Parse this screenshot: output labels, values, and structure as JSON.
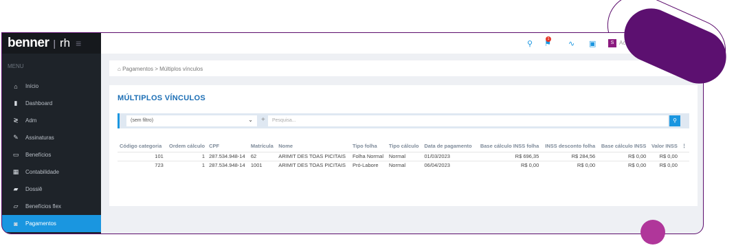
{
  "logo": {
    "brand": "benner",
    "module": "rh"
  },
  "sidebar": {
    "menu_heading": "MENU",
    "items": [
      {
        "label": "Início",
        "icon": "home-icon"
      },
      {
        "label": "Dashboard",
        "icon": "bar-chart-icon"
      },
      {
        "label": "Adm",
        "icon": "sliders-icon"
      },
      {
        "label": "Assinaturas",
        "icon": "signature-icon"
      },
      {
        "label": "Benefícios",
        "icon": "card-icon"
      },
      {
        "label": "Contabilidade",
        "icon": "calculator-icon"
      },
      {
        "label": "Dossiê",
        "icon": "folder-icon"
      },
      {
        "label": "Benefícios flex",
        "icon": "flex-card-icon"
      },
      {
        "label": "Pagamentos",
        "icon": "payment-icon",
        "active": true
      }
    ]
  },
  "topbar": {
    "notification_count": "1",
    "avatar_letter": "S",
    "user_label": "Ac"
  },
  "breadcrumb": {
    "text": "Pagamentos > Múltiplos vínculos"
  },
  "page": {
    "title": "MÚLTIPLOS VÍNCULOS"
  },
  "filter": {
    "selected": "(sem filtro)",
    "search_placeholder": "Pesquisa..."
  },
  "table": {
    "headers": [
      "Código categoria",
      "Ordem cálculo",
      "CPF",
      "Matrícula",
      "Nome",
      "Tipo folha",
      "Tipo cálculo",
      "Data de pagamento",
      "Base cálculo INSS folha",
      "INSS desconto folha",
      "Base cálculo INSS",
      "Valor INSS"
    ],
    "rows": [
      [
        "101",
        "1",
        "287.534.948-14",
        "62",
        "ARIMIT DES TOAS PICITAIS",
        "Folha Normal",
        "Normal",
        "01/03/2023",
        "R$ 696,35",
        "R$ 284,56",
        "R$ 0,00",
        "R$ 0,00"
      ],
      [
        "723",
        "1",
        "287.534.948-14",
        "1001",
        "ARIMIT DES TOAS PICITAIS",
        "Pró-Labore",
        "Normal",
        "06/04/2023",
        "R$ 0,00",
        "R$ 0,00",
        "R$ 0,00",
        "R$ 0,00"
      ]
    ]
  },
  "colors": {
    "accent": "#1a96e0",
    "brand_purple": "#5c1070",
    "title_blue": "#1b6eb5"
  }
}
